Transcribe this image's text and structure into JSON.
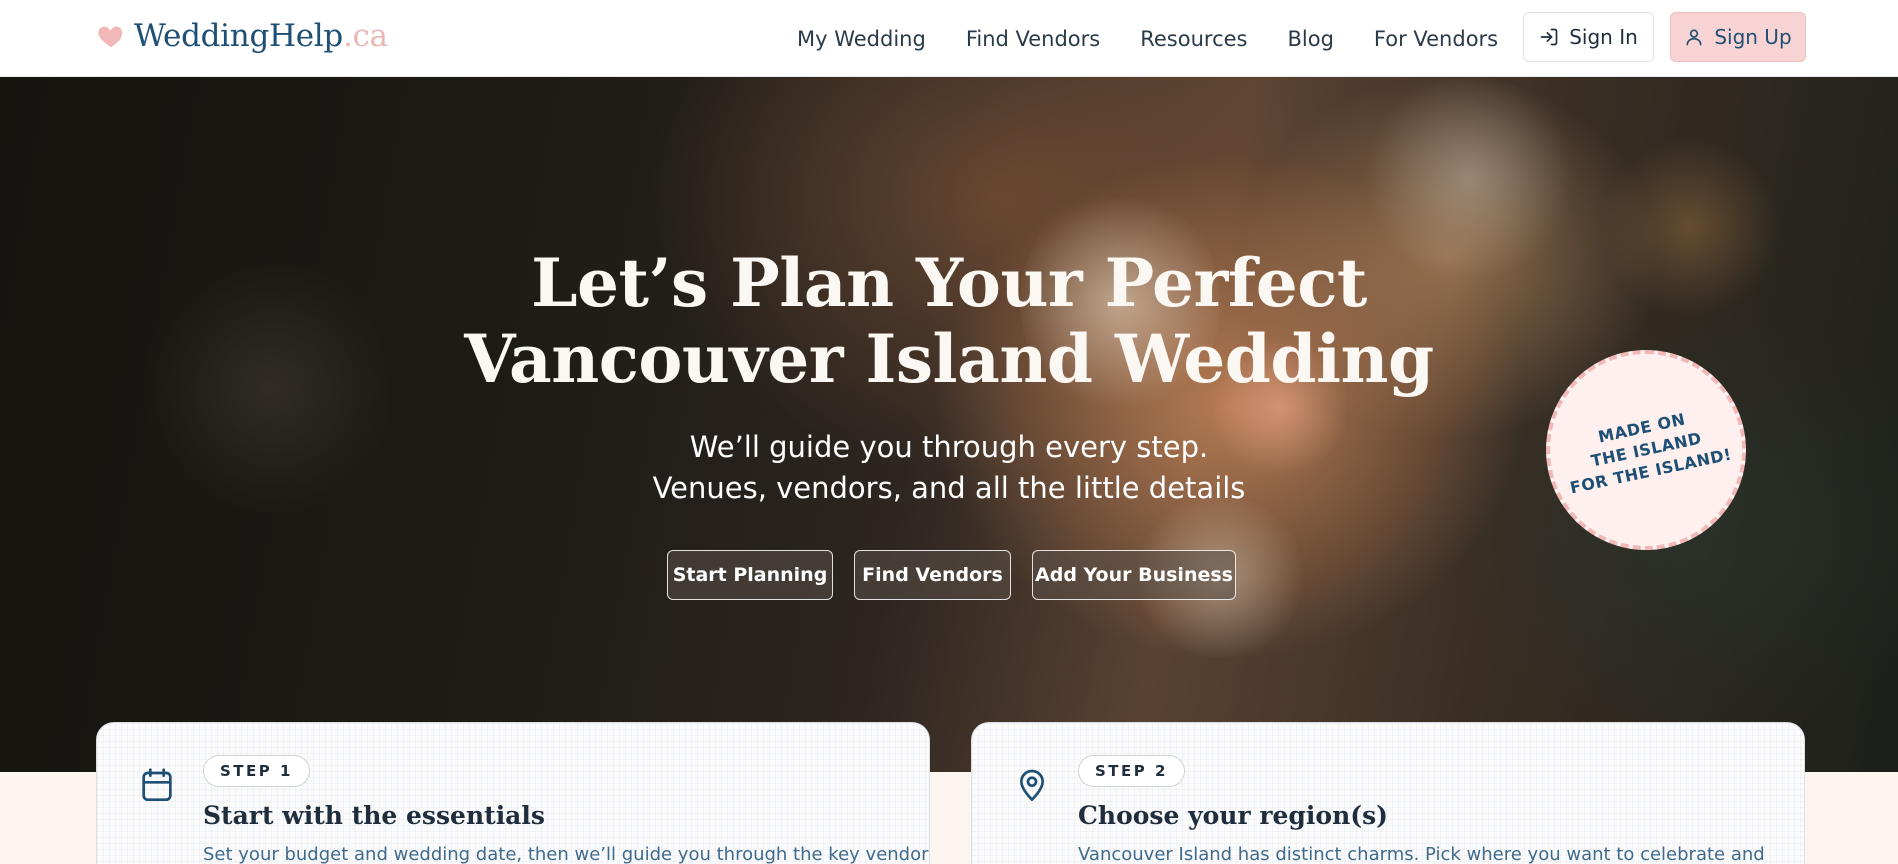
{
  "brand": {
    "name": "WeddingHelp",
    "tld": ".ca"
  },
  "nav": {
    "links": [
      "My Wedding",
      "Find Vendors",
      "Resources",
      "Blog",
      "For Vendors"
    ],
    "signin_label": "Sign In",
    "signup_label": "Sign Up"
  },
  "hero": {
    "title_line1": "Let’s Plan Your Perfect",
    "title_line2": "Vancouver Island Wedding",
    "subtitle_line1": "We’ll guide you through every step.",
    "subtitle_line2": "Venues, vendors, and all the little details",
    "buttons": [
      "Start Planning",
      "Find Vendors",
      "Add Your Business"
    ],
    "badge_lines": [
      "MADE ON",
      "THE ISLAND",
      "FOR THE ISLAND!"
    ]
  },
  "steps": [
    {
      "pill": "STEP 1",
      "title": "Start with the essentials",
      "description": "Set your budget and wedding date, then we’ll guide you through the key vendor",
      "icon": "calendar-icon"
    },
    {
      "pill": "STEP 2",
      "title": "Choose your region(s)",
      "description": "Vancouver Island has distinct charms. Pick where you want to celebrate and",
      "icon": "map-pin-icon"
    }
  ],
  "colors": {
    "brand_blue": "#1e4f74",
    "brand_pink": "#f7d3d3",
    "logo_tld_pink": "#eab7b7",
    "cream_bg": "#fdf6f0"
  }
}
